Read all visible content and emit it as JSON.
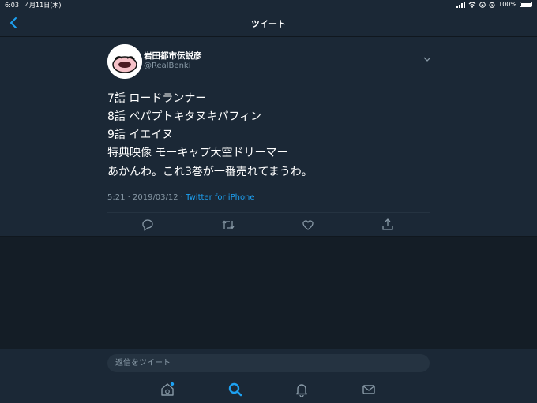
{
  "status_bar": {
    "time": "6:03",
    "date": "4月11日(木)",
    "battery": "100%"
  },
  "nav": {
    "title": "ツイート",
    "back_icon": "chevron-left-icon"
  },
  "tweet": {
    "author_name": "岩田都市伝説彦",
    "handle": "@RealBenki",
    "lines": [
      "7話 ロードランナー",
      "8話 ペパプトキタヌキパフィン",
      "9話 イエイヌ",
      "特典映像 モーキャプ大空ドリーマー"
    ],
    "extra": "あかんわ。これ3巻が一番売れてまうわ。",
    "timestamp": "5:21 · 2019/03/12 · ",
    "source": "Twitter for iPhone",
    "actions": [
      "reply-icon",
      "retweet-icon",
      "like-icon",
      "share-icon"
    ]
  },
  "reply_box": {
    "placeholder": "返信をツイート"
  },
  "tabbar": {
    "items": [
      "home-icon",
      "search-icon",
      "notifications-icon",
      "messages-icon"
    ]
  },
  "colors": {
    "background": "#141d26",
    "panel": "#1b2836",
    "accent": "#1da1f2",
    "secondary_text": "#8899a6"
  }
}
